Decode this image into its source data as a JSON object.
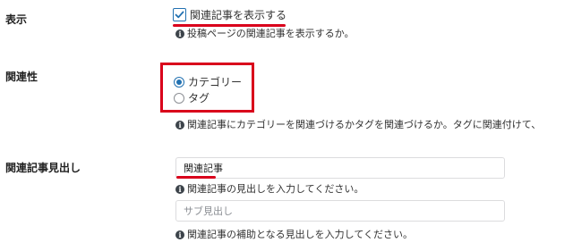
{
  "display": {
    "label": "表示",
    "checkbox_label": "関連記事を表示する",
    "checkbox_checked": true,
    "help": "投稿ページの関連記事を表示するか。"
  },
  "relation": {
    "label": "関連性",
    "options": [
      {
        "label": "カテゴリー",
        "selected": true
      },
      {
        "label": "タグ",
        "selected": false
      }
    ],
    "help": "関連記事にカテゴリーを関連づけるかタグを関連づけるか。タグに関連付けて、"
  },
  "heading": {
    "label": "関連記事見出し",
    "title_value": "関連記事",
    "title_help": "関連記事の見出しを入力してください。",
    "subtitle_placeholder": "サブ見出し",
    "subtitle_help": "関連記事の補助となる見出しを入力してください。"
  },
  "colors": {
    "accent": "#2271b1",
    "annotation_red": "#d9001b"
  },
  "icons": {
    "help": "info-circle-icon",
    "checkbox": "checkmark-icon"
  }
}
